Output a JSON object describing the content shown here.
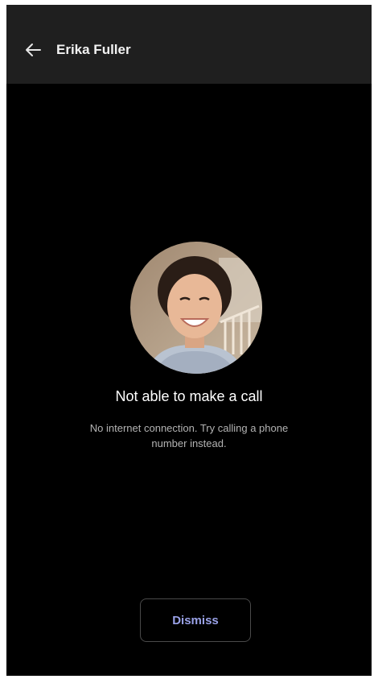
{
  "header": {
    "title": "Erika Fuller",
    "back_icon": "arrow-left-icon"
  },
  "call_status": {
    "avatar_icon": "contact-photo",
    "title": "Not able to make a call",
    "message": "No internet connection. Try calling a phone number instead."
  },
  "actions": {
    "dismiss_label": "Dismiss"
  },
  "colors": {
    "background": "#000000",
    "header_background": "#1f1f1f",
    "accent": "#9aa2e8"
  }
}
